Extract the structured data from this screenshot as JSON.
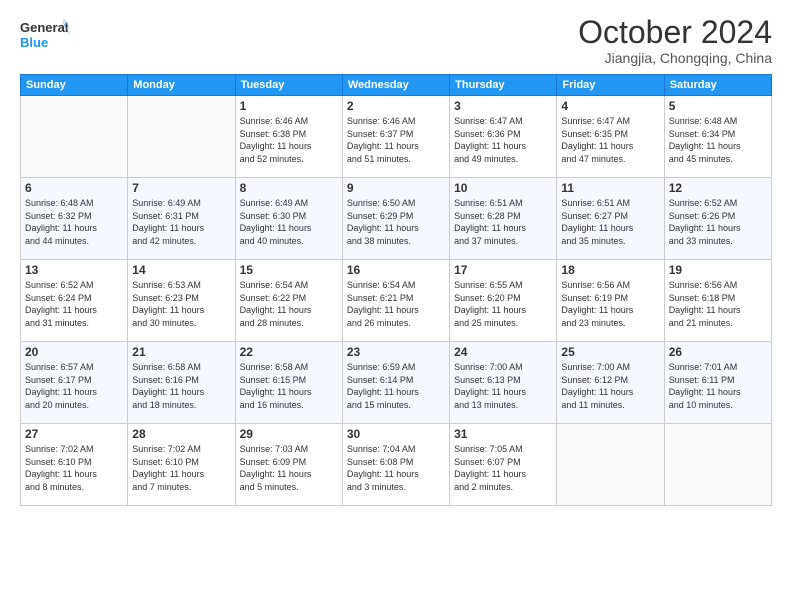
{
  "logo": {
    "line1": "General",
    "line2": "Blue"
  },
  "header": {
    "month": "October 2024",
    "location": "Jiangjia, Chongqing, China"
  },
  "weekdays": [
    "Sunday",
    "Monday",
    "Tuesday",
    "Wednesday",
    "Thursday",
    "Friday",
    "Saturday"
  ],
  "weeks": [
    [
      {
        "day": "",
        "info": ""
      },
      {
        "day": "",
        "info": ""
      },
      {
        "day": "1",
        "info": "Sunrise: 6:46 AM\nSunset: 6:38 PM\nDaylight: 11 hours\nand 52 minutes."
      },
      {
        "day": "2",
        "info": "Sunrise: 6:46 AM\nSunset: 6:37 PM\nDaylight: 11 hours\nand 51 minutes."
      },
      {
        "day": "3",
        "info": "Sunrise: 6:47 AM\nSunset: 6:36 PM\nDaylight: 11 hours\nand 49 minutes."
      },
      {
        "day": "4",
        "info": "Sunrise: 6:47 AM\nSunset: 6:35 PM\nDaylight: 11 hours\nand 47 minutes."
      },
      {
        "day": "5",
        "info": "Sunrise: 6:48 AM\nSunset: 6:34 PM\nDaylight: 11 hours\nand 45 minutes."
      }
    ],
    [
      {
        "day": "6",
        "info": "Sunrise: 6:48 AM\nSunset: 6:32 PM\nDaylight: 11 hours\nand 44 minutes."
      },
      {
        "day": "7",
        "info": "Sunrise: 6:49 AM\nSunset: 6:31 PM\nDaylight: 11 hours\nand 42 minutes."
      },
      {
        "day": "8",
        "info": "Sunrise: 6:49 AM\nSunset: 6:30 PM\nDaylight: 11 hours\nand 40 minutes."
      },
      {
        "day": "9",
        "info": "Sunrise: 6:50 AM\nSunset: 6:29 PM\nDaylight: 11 hours\nand 38 minutes."
      },
      {
        "day": "10",
        "info": "Sunrise: 6:51 AM\nSunset: 6:28 PM\nDaylight: 11 hours\nand 37 minutes."
      },
      {
        "day": "11",
        "info": "Sunrise: 6:51 AM\nSunset: 6:27 PM\nDaylight: 11 hours\nand 35 minutes."
      },
      {
        "day": "12",
        "info": "Sunrise: 6:52 AM\nSunset: 6:26 PM\nDaylight: 11 hours\nand 33 minutes."
      }
    ],
    [
      {
        "day": "13",
        "info": "Sunrise: 6:52 AM\nSunset: 6:24 PM\nDaylight: 11 hours\nand 31 minutes."
      },
      {
        "day": "14",
        "info": "Sunrise: 6:53 AM\nSunset: 6:23 PM\nDaylight: 11 hours\nand 30 minutes."
      },
      {
        "day": "15",
        "info": "Sunrise: 6:54 AM\nSunset: 6:22 PM\nDaylight: 11 hours\nand 28 minutes."
      },
      {
        "day": "16",
        "info": "Sunrise: 6:54 AM\nSunset: 6:21 PM\nDaylight: 11 hours\nand 26 minutes."
      },
      {
        "day": "17",
        "info": "Sunrise: 6:55 AM\nSunset: 6:20 PM\nDaylight: 11 hours\nand 25 minutes."
      },
      {
        "day": "18",
        "info": "Sunrise: 6:56 AM\nSunset: 6:19 PM\nDaylight: 11 hours\nand 23 minutes."
      },
      {
        "day": "19",
        "info": "Sunrise: 6:56 AM\nSunset: 6:18 PM\nDaylight: 11 hours\nand 21 minutes."
      }
    ],
    [
      {
        "day": "20",
        "info": "Sunrise: 6:57 AM\nSunset: 6:17 PM\nDaylight: 11 hours\nand 20 minutes."
      },
      {
        "day": "21",
        "info": "Sunrise: 6:58 AM\nSunset: 6:16 PM\nDaylight: 11 hours\nand 18 minutes."
      },
      {
        "day": "22",
        "info": "Sunrise: 6:58 AM\nSunset: 6:15 PM\nDaylight: 11 hours\nand 16 minutes."
      },
      {
        "day": "23",
        "info": "Sunrise: 6:59 AM\nSunset: 6:14 PM\nDaylight: 11 hours\nand 15 minutes."
      },
      {
        "day": "24",
        "info": "Sunrise: 7:00 AM\nSunset: 6:13 PM\nDaylight: 11 hours\nand 13 minutes."
      },
      {
        "day": "25",
        "info": "Sunrise: 7:00 AM\nSunset: 6:12 PM\nDaylight: 11 hours\nand 11 minutes."
      },
      {
        "day": "26",
        "info": "Sunrise: 7:01 AM\nSunset: 6:11 PM\nDaylight: 11 hours\nand 10 minutes."
      }
    ],
    [
      {
        "day": "27",
        "info": "Sunrise: 7:02 AM\nSunset: 6:10 PM\nDaylight: 11 hours\nand 8 minutes."
      },
      {
        "day": "28",
        "info": "Sunrise: 7:02 AM\nSunset: 6:10 PM\nDaylight: 11 hours\nand 7 minutes."
      },
      {
        "day": "29",
        "info": "Sunrise: 7:03 AM\nSunset: 6:09 PM\nDaylight: 11 hours\nand 5 minutes."
      },
      {
        "day": "30",
        "info": "Sunrise: 7:04 AM\nSunset: 6:08 PM\nDaylight: 11 hours\nand 3 minutes."
      },
      {
        "day": "31",
        "info": "Sunrise: 7:05 AM\nSunset: 6:07 PM\nDaylight: 11 hours\nand 2 minutes."
      },
      {
        "day": "",
        "info": ""
      },
      {
        "day": "",
        "info": ""
      }
    ]
  ]
}
